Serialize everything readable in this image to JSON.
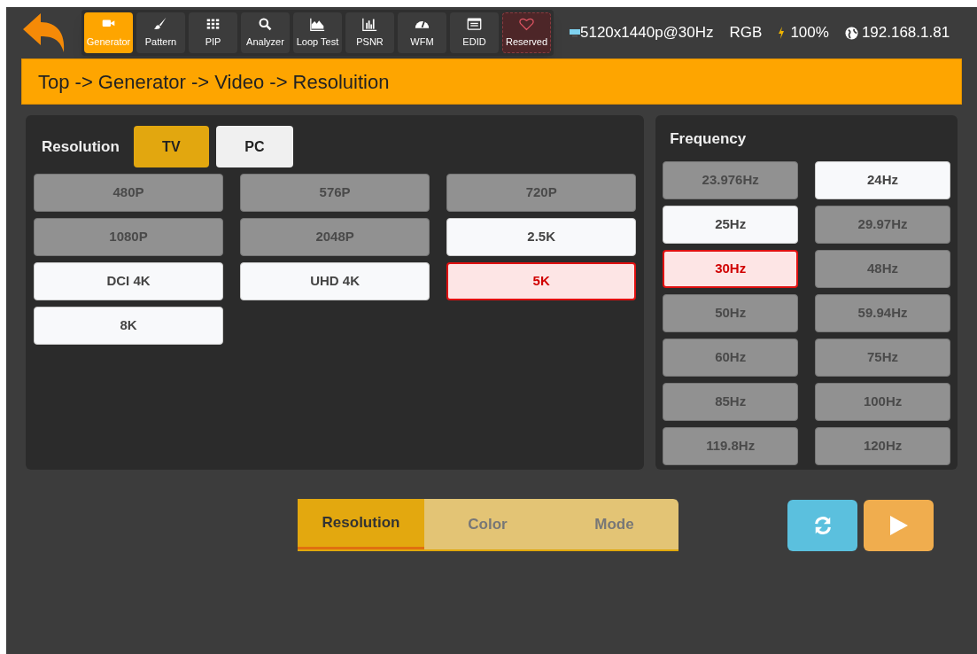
{
  "toolbar": {
    "tabs": [
      {
        "kind": "camera",
        "label": "Generator",
        "selected": true
      },
      {
        "kind": "brush",
        "label": "Pattern",
        "selected": false
      },
      {
        "kind": "grid",
        "label": "PIP",
        "selected": false
      },
      {
        "kind": "search",
        "label": "Analyzer",
        "selected": false
      },
      {
        "kind": "area",
        "label": "Loop Test",
        "selected": false
      },
      {
        "kind": "bars",
        "label": "PSNR",
        "selected": false
      },
      {
        "kind": "gauge",
        "label": "WFM",
        "selected": false
      },
      {
        "kind": "list",
        "label": "EDID",
        "selected": false
      },
      {
        "kind": "heart",
        "label": "Reserved",
        "selected": false,
        "reserved": true
      }
    ]
  },
  "status": {
    "signal": "5120x1440p@30Hz",
    "color_space": "RGB",
    "power": "100%",
    "ip": "192.168.1.81"
  },
  "breadcrumb": "Top -> Generator -> Video -> Resoluition",
  "resolution_panel": {
    "label": "Resolution",
    "modes": [
      {
        "label": "TV",
        "selected": true
      },
      {
        "label": "PC",
        "selected": false
      }
    ],
    "options": [
      {
        "label": "480P",
        "disabled": true,
        "selected": false
      },
      {
        "label": "576P",
        "disabled": true,
        "selected": false
      },
      {
        "label": "720P",
        "disabled": true,
        "selected": false
      },
      {
        "label": "1080P",
        "disabled": true,
        "selected": false
      },
      {
        "label": "2048P",
        "disabled": true,
        "selected": false
      },
      {
        "label": "2.5K",
        "disabled": false,
        "selected": false
      },
      {
        "label": "DCI 4K",
        "disabled": false,
        "selected": false
      },
      {
        "label": "UHD 4K",
        "disabled": false,
        "selected": false
      },
      {
        "label": "5K",
        "disabled": false,
        "selected": true
      },
      {
        "label": "8K",
        "disabled": false,
        "selected": false
      }
    ]
  },
  "frequency_panel": {
    "title": "Frequency",
    "options": [
      {
        "label": "23.976Hz",
        "disabled": true,
        "selected": false
      },
      {
        "label": "24Hz",
        "disabled": false,
        "selected": false
      },
      {
        "label": "25Hz",
        "disabled": false,
        "selected": false
      },
      {
        "label": "29.97Hz",
        "disabled": true,
        "selected": false
      },
      {
        "label": "30Hz",
        "disabled": false,
        "selected": true
      },
      {
        "label": "48Hz",
        "disabled": true,
        "selected": false
      },
      {
        "label": "50Hz",
        "disabled": true,
        "selected": false
      },
      {
        "label": "59.94Hz",
        "disabled": true,
        "selected": false
      },
      {
        "label": "60Hz",
        "disabled": true,
        "selected": false
      },
      {
        "label": "75Hz",
        "disabled": true,
        "selected": false
      },
      {
        "label": "85Hz",
        "disabled": true,
        "selected": false
      },
      {
        "label": "100Hz",
        "disabled": true,
        "selected": false
      },
      {
        "label": "119.8Hz",
        "disabled": true,
        "selected": false
      },
      {
        "label": "120Hz",
        "disabled": true,
        "selected": false
      }
    ]
  },
  "bottom_tabs": [
    {
      "label": "Resolution",
      "selected": true
    },
    {
      "label": "Color",
      "selected": false
    },
    {
      "label": "Mode",
      "selected": false
    }
  ]
}
